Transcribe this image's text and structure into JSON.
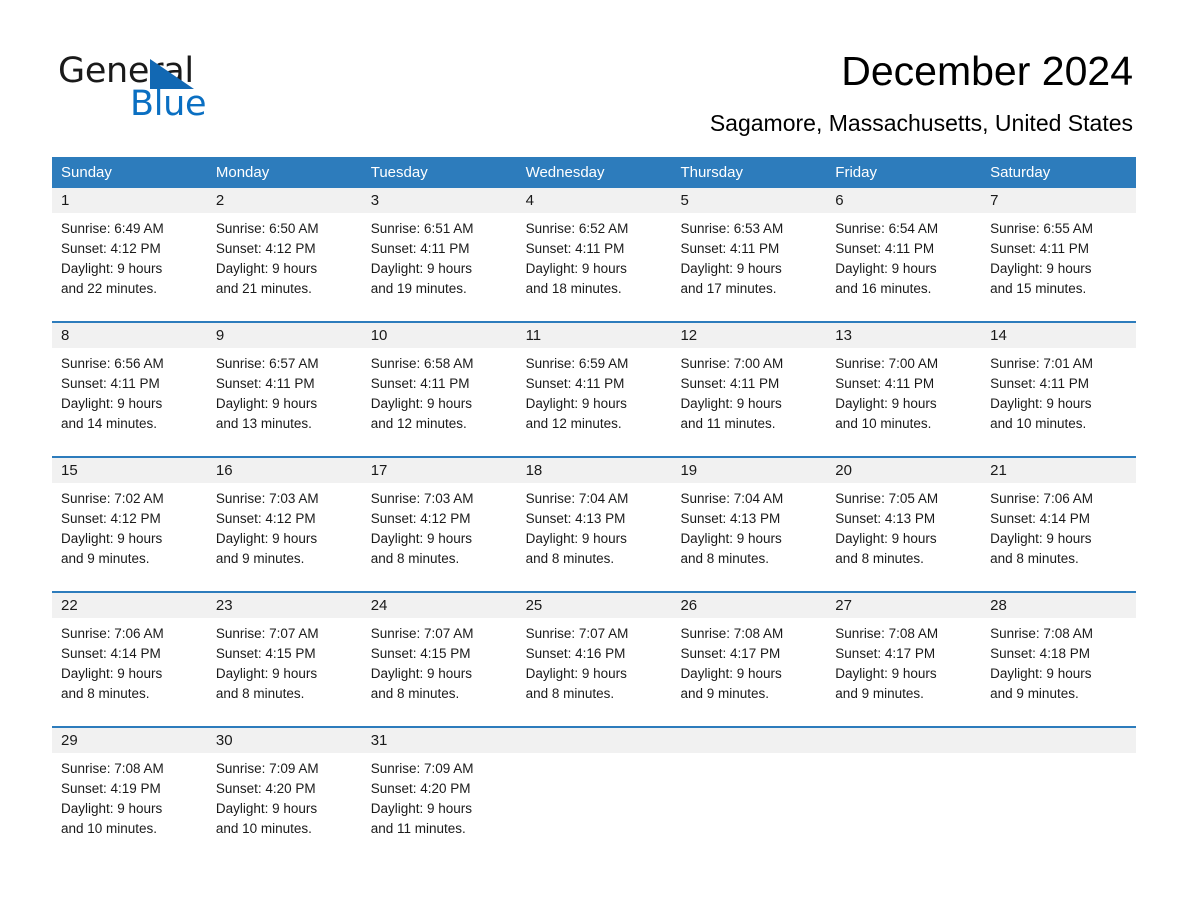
{
  "brand": {
    "name_part1": "General",
    "name_part2": "Blue",
    "triangle_color": "#1268b3",
    "blue_color": "#0a6fc2"
  },
  "header": {
    "title": "December 2024",
    "subtitle": "Sagamore, Massachusetts, United States"
  },
  "theme": {
    "header_blue": "#2d7cbc",
    "date_band_gray": "#f1f1f1",
    "rule_blue": "#2d7cbc",
    "text_color": "#1a1a1a"
  },
  "weekdays": [
    "Sunday",
    "Monday",
    "Tuesday",
    "Wednesday",
    "Thursday",
    "Friday",
    "Saturday"
  ],
  "weeks": [
    {
      "days": [
        {
          "date": "1",
          "lines": [
            "Sunrise: 6:49 AM",
            "Sunset: 4:12 PM",
            "Daylight: 9 hours",
            "and 22 minutes."
          ]
        },
        {
          "date": "2",
          "lines": [
            "Sunrise: 6:50 AM",
            "Sunset: 4:12 PM",
            "Daylight: 9 hours",
            "and 21 minutes."
          ]
        },
        {
          "date": "3",
          "lines": [
            "Sunrise: 6:51 AM",
            "Sunset: 4:11 PM",
            "Daylight: 9 hours",
            "and 19 minutes."
          ]
        },
        {
          "date": "4",
          "lines": [
            "Sunrise: 6:52 AM",
            "Sunset: 4:11 PM",
            "Daylight: 9 hours",
            "and 18 minutes."
          ]
        },
        {
          "date": "5",
          "lines": [
            "Sunrise: 6:53 AM",
            "Sunset: 4:11 PM",
            "Daylight: 9 hours",
            "and 17 minutes."
          ]
        },
        {
          "date": "6",
          "lines": [
            "Sunrise: 6:54 AM",
            "Sunset: 4:11 PM",
            "Daylight: 9 hours",
            "and 16 minutes."
          ]
        },
        {
          "date": "7",
          "lines": [
            "Sunrise: 6:55 AM",
            "Sunset: 4:11 PM",
            "Daylight: 9 hours",
            "and 15 minutes."
          ]
        }
      ]
    },
    {
      "days": [
        {
          "date": "8",
          "lines": [
            "Sunrise: 6:56 AM",
            "Sunset: 4:11 PM",
            "Daylight: 9 hours",
            "and 14 minutes."
          ]
        },
        {
          "date": "9",
          "lines": [
            "Sunrise: 6:57 AM",
            "Sunset: 4:11 PM",
            "Daylight: 9 hours",
            "and 13 minutes."
          ]
        },
        {
          "date": "10",
          "lines": [
            "Sunrise: 6:58 AM",
            "Sunset: 4:11 PM",
            "Daylight: 9 hours",
            "and 12 minutes."
          ]
        },
        {
          "date": "11",
          "lines": [
            "Sunrise: 6:59 AM",
            "Sunset: 4:11 PM",
            "Daylight: 9 hours",
            "and 12 minutes."
          ]
        },
        {
          "date": "12",
          "lines": [
            "Sunrise: 7:00 AM",
            "Sunset: 4:11 PM",
            "Daylight: 9 hours",
            "and 11 minutes."
          ]
        },
        {
          "date": "13",
          "lines": [
            "Sunrise: 7:00 AM",
            "Sunset: 4:11 PM",
            "Daylight: 9 hours",
            "and 10 minutes."
          ]
        },
        {
          "date": "14",
          "lines": [
            "Sunrise: 7:01 AM",
            "Sunset: 4:11 PM",
            "Daylight: 9 hours",
            "and 10 minutes."
          ]
        }
      ]
    },
    {
      "days": [
        {
          "date": "15",
          "lines": [
            "Sunrise: 7:02 AM",
            "Sunset: 4:12 PM",
            "Daylight: 9 hours",
            "and 9 minutes."
          ]
        },
        {
          "date": "16",
          "lines": [
            "Sunrise: 7:03 AM",
            "Sunset: 4:12 PM",
            "Daylight: 9 hours",
            "and 9 minutes."
          ]
        },
        {
          "date": "17",
          "lines": [
            "Sunrise: 7:03 AM",
            "Sunset: 4:12 PM",
            "Daylight: 9 hours",
            "and 8 minutes."
          ]
        },
        {
          "date": "18",
          "lines": [
            "Sunrise: 7:04 AM",
            "Sunset: 4:13 PM",
            "Daylight: 9 hours",
            "and 8 minutes."
          ]
        },
        {
          "date": "19",
          "lines": [
            "Sunrise: 7:04 AM",
            "Sunset: 4:13 PM",
            "Daylight: 9 hours",
            "and 8 minutes."
          ]
        },
        {
          "date": "20",
          "lines": [
            "Sunrise: 7:05 AM",
            "Sunset: 4:13 PM",
            "Daylight: 9 hours",
            "and 8 minutes."
          ]
        },
        {
          "date": "21",
          "lines": [
            "Sunrise: 7:06 AM",
            "Sunset: 4:14 PM",
            "Daylight: 9 hours",
            "and 8 minutes."
          ]
        }
      ]
    },
    {
      "days": [
        {
          "date": "22",
          "lines": [
            "Sunrise: 7:06 AM",
            "Sunset: 4:14 PM",
            "Daylight: 9 hours",
            "and 8 minutes."
          ]
        },
        {
          "date": "23",
          "lines": [
            "Sunrise: 7:07 AM",
            "Sunset: 4:15 PM",
            "Daylight: 9 hours",
            "and 8 minutes."
          ]
        },
        {
          "date": "24",
          "lines": [
            "Sunrise: 7:07 AM",
            "Sunset: 4:15 PM",
            "Daylight: 9 hours",
            "and 8 minutes."
          ]
        },
        {
          "date": "25",
          "lines": [
            "Sunrise: 7:07 AM",
            "Sunset: 4:16 PM",
            "Daylight: 9 hours",
            "and 8 minutes."
          ]
        },
        {
          "date": "26",
          "lines": [
            "Sunrise: 7:08 AM",
            "Sunset: 4:17 PM",
            "Daylight: 9 hours",
            "and 9 minutes."
          ]
        },
        {
          "date": "27",
          "lines": [
            "Sunrise: 7:08 AM",
            "Sunset: 4:17 PM",
            "Daylight: 9 hours",
            "and 9 minutes."
          ]
        },
        {
          "date": "28",
          "lines": [
            "Sunrise: 7:08 AM",
            "Sunset: 4:18 PM",
            "Daylight: 9 hours",
            "and 9 minutes."
          ]
        }
      ]
    },
    {
      "days": [
        {
          "date": "29",
          "lines": [
            "Sunrise: 7:08 AM",
            "Sunset: 4:19 PM",
            "Daylight: 9 hours",
            "and 10 minutes."
          ]
        },
        {
          "date": "30",
          "lines": [
            "Sunrise: 7:09 AM",
            "Sunset: 4:20 PM",
            "Daylight: 9 hours",
            "and 10 minutes."
          ]
        },
        {
          "date": "31",
          "lines": [
            "Sunrise: 7:09 AM",
            "Sunset: 4:20 PM",
            "Daylight: 9 hours",
            "and 11 minutes."
          ]
        },
        {
          "date": "",
          "lines": []
        },
        {
          "date": "",
          "lines": []
        },
        {
          "date": "",
          "lines": []
        },
        {
          "date": "",
          "lines": []
        }
      ]
    }
  ]
}
